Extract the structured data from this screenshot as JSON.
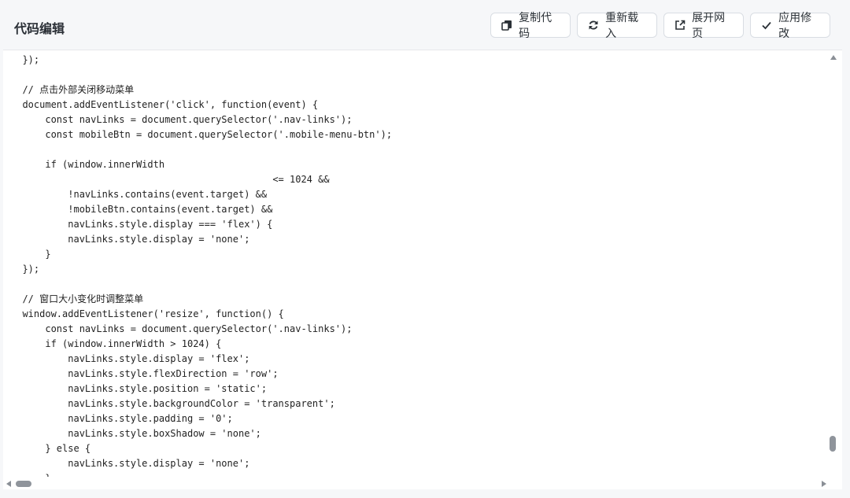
{
  "header": {
    "title": "代码编辑",
    "buttons": {
      "copy": "复制代码",
      "reload": "重新载入",
      "open": "展开网页",
      "apply": "应用修改"
    }
  },
  "code": {
    "lines": [
      "  });",
      "",
      "  // 点击外部关闭移动菜单",
      "  document.addEventListener('click', function(event) {",
      "      const navLinks = document.querySelector('.nav-links');",
      "      const mobileBtn = document.querySelector('.mobile-menu-btn');",
      "",
      "      if (window.innerWidth",
      "                                              <= 1024 &&",
      "          !navLinks.contains(event.target) &&",
      "          !mobileBtn.contains(event.target) &&",
      "          navLinks.style.display === 'flex') {",
      "          navLinks.style.display = 'none';",
      "      }",
      "  });",
      "",
      "  // 窗口大小变化时调整菜单",
      "  window.addEventListener('resize', function() {",
      "      const navLinks = document.querySelector('.nav-links');",
      "      if (window.innerWidth > 1024) {",
      "          navLinks.style.display = 'flex';",
      "          navLinks.style.flexDirection = 'row';",
      "          navLinks.style.position = 'static';",
      "          navLinks.style.backgroundColor = 'transparent';",
      "          navLinks.style.padding = '0';",
      "          navLinks.style.boxShadow = 'none';",
      "      } else {",
      "          navLinks.style.display = 'none';",
      "      }"
    ]
  }
}
